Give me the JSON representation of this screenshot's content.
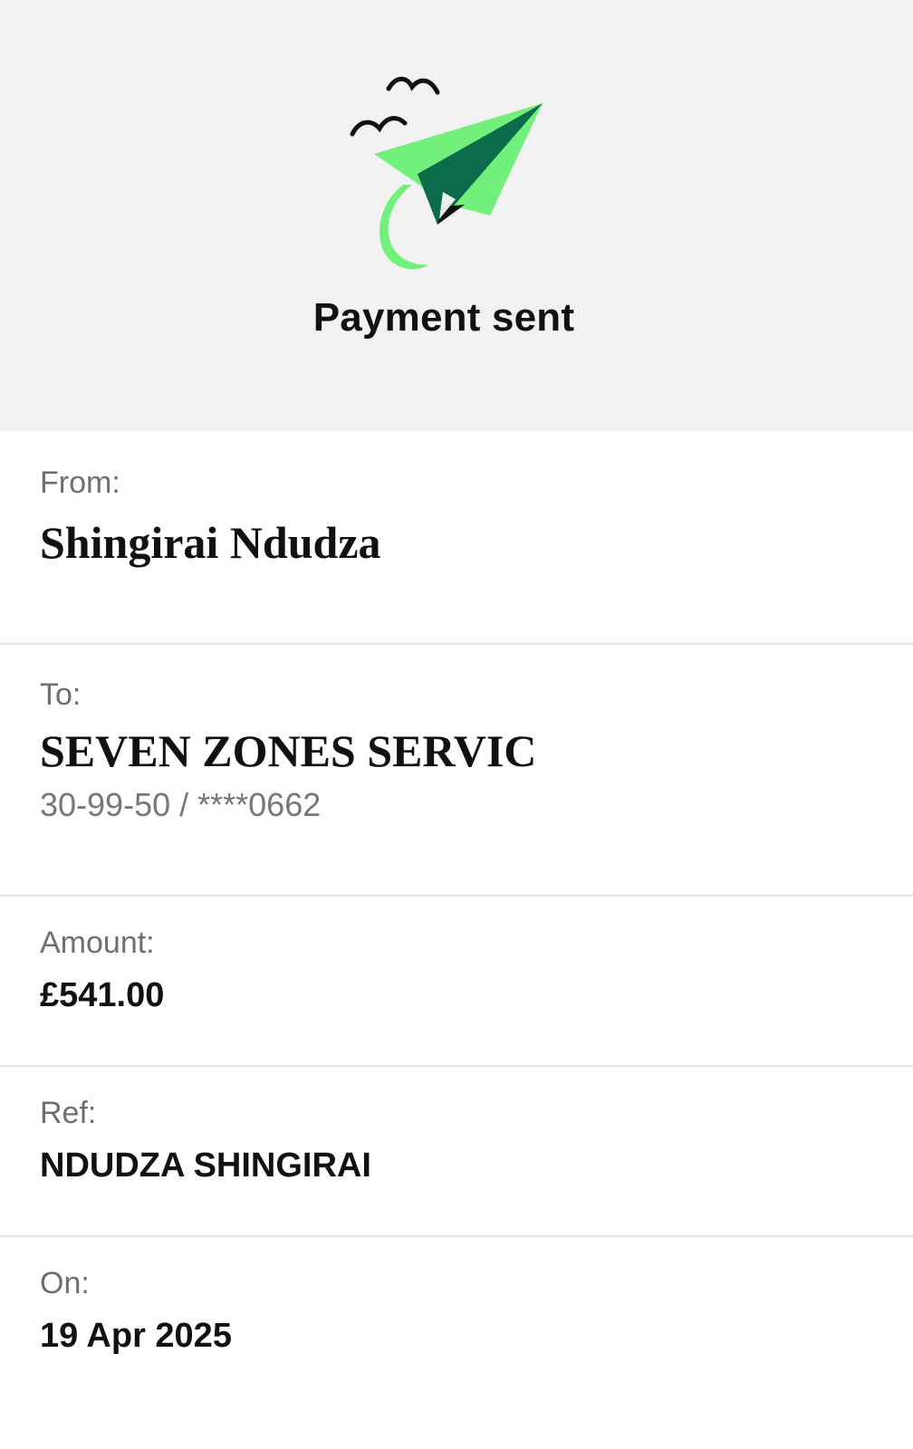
{
  "header": {
    "title": "Payment sent",
    "colors": {
      "background": "#f2f2f2",
      "plane_light": "#72f07c",
      "plane_dark": "#0b6b4a",
      "plane_black": "#111111"
    }
  },
  "details": {
    "from": {
      "label": "From:",
      "value": "Shingirai Ndudza"
    },
    "to": {
      "label": "To:",
      "value": "SEVEN ZONES SERVIC",
      "account": "30-99-50 / ****0662"
    },
    "amount": {
      "label": "Amount:",
      "value": "£541.00"
    },
    "ref": {
      "label": "Ref:",
      "value": "NDUDZA SHINGIRAI"
    },
    "on": {
      "label": "On:",
      "value": "19 Apr 2025"
    }
  }
}
